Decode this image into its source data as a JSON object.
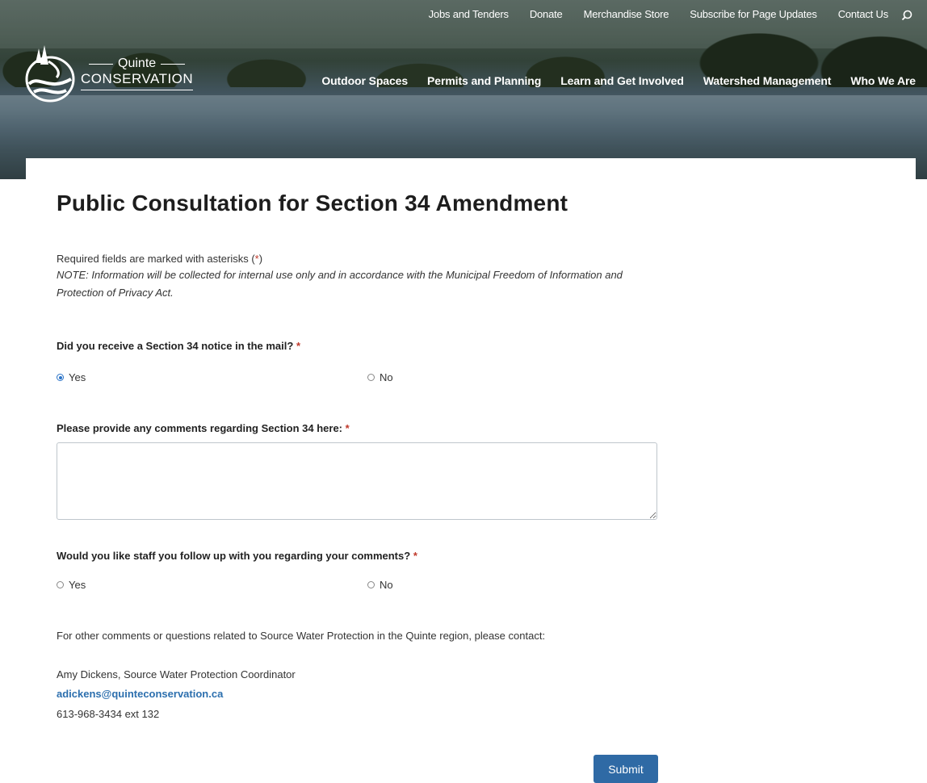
{
  "topnav": {
    "items": [
      "Jobs and Tenders",
      "Donate",
      "Merchandise Store",
      "Subscribe for Page Updates",
      "Contact Us"
    ]
  },
  "logo": {
    "line1": "Quinte",
    "line2": "CONSERVATION"
  },
  "mainnav": {
    "items": [
      "Outdoor Spaces",
      "Permits and Planning",
      "Learn and Get Involved",
      "Watershed Management",
      "Who We Are"
    ]
  },
  "page": {
    "title": "Public Consultation for Section 34 Amendment"
  },
  "form": {
    "required_note_prefix": "Required fields are marked with asterisks (",
    "required_note_star": "*",
    "required_note_suffix": ")",
    "privacy_note": "NOTE: Information will be collected for internal use only and in accordance with the Municipal Freedom of Information and Protection of Privacy Act.",
    "q1": {
      "label": "Did you receive a Section 34 notice in the mail?",
      "star": "*",
      "options": [
        "Yes",
        "No"
      ],
      "selected": "Yes"
    },
    "q2": {
      "label": "Please provide any comments regarding Section 34 here:",
      "star": "*",
      "value": ""
    },
    "q3": {
      "label": "Would you like staff you follow up with you regarding your comments?",
      "star": "*",
      "options": [
        "Yes",
        "No"
      ],
      "selected": ""
    },
    "contact_intro": "For other comments or questions related to Source Water Protection in the Quinte region, please contact:",
    "contact_name": "Amy Dickens, Source Water Protection Coordinator",
    "contact_email": "adickens@quinteconservation.ca",
    "contact_phone": "613-968-3434 ext 132",
    "submit_label": "Submit"
  },
  "colors": {
    "accent": "#2f6aa5",
    "required": "#c0392b",
    "link": "#2c6fae",
    "radio_selected": "#2a73c7"
  }
}
